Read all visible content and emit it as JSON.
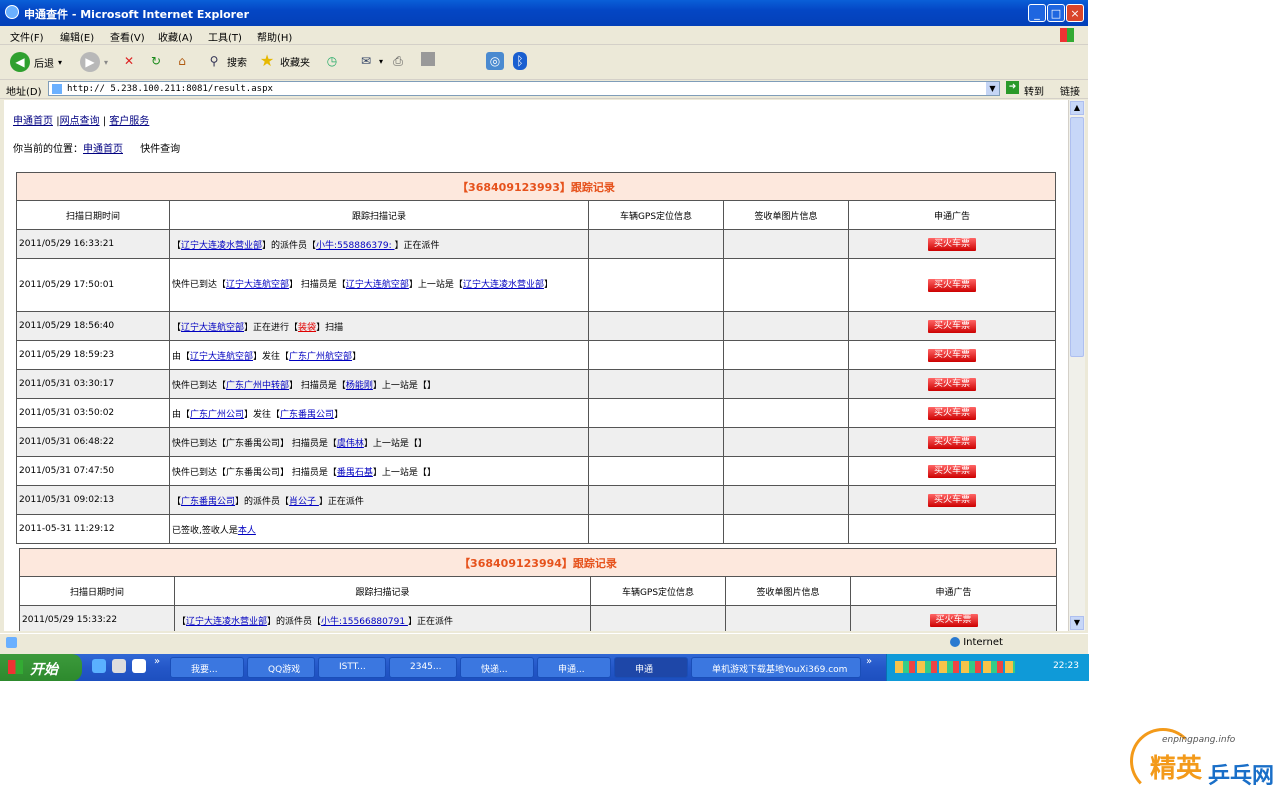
{
  "window": {
    "title": "申通查件 - Microsoft Internet Explorer",
    "min": "_",
    "max": "□",
    "close": "×"
  },
  "menu": [
    "文件(F)",
    "编辑(E)",
    "查看(V)",
    "收藏(A)",
    "工具(T)",
    "帮助(H)"
  ],
  "toolbar": {
    "back": "后退",
    "search": "搜索",
    "favorites": "收藏夹"
  },
  "address": {
    "label": "地址(D)",
    "url": "http://  5.238.100.211:8081/result.aspx",
    "go": "转到",
    "links": "链接"
  },
  "nav": {
    "home": "申通首页",
    "sep1": "|",
    "outlet": "网点查询",
    "sep2": "|",
    "service": "客户服务"
  },
  "breadcrumb": {
    "prefix": "你当前的位置：",
    "home": "申通首页",
    "current": "快件查询"
  },
  "columns": [
    "扫描日期时间",
    "跟踪扫描记录",
    "车辆GPS定位信息",
    "签收单图片信息",
    "申通广告"
  ],
  "ad_label": "买火车票",
  "tracking": [
    {
      "title": "【368409123993】跟踪记录",
      "rows": [
        {
          "time": "2011/05/29 16:33:21",
          "parts": [
            [
              "",
              "【"
            ],
            [
              "b",
              "辽宁大连凌水营业部"
            ],
            [
              "",
              "】的派件员【"
            ],
            [
              "b",
              "小牛:558886379: "
            ],
            [
              "",
              "】正在派件"
            ]
          ],
          "ad": true,
          "tall": false
        },
        {
          "time": "2011/05/29 17:50:01",
          "parts": [
            [
              "",
              "快件已到达【"
            ],
            [
              "b",
              "辽宁大连航空部"
            ],
            [
              "",
              "】 扫描员是【"
            ],
            [
              "b",
              "辽宁大连航空部"
            ],
            [
              "",
              "】上一站是【"
            ],
            [
              "b",
              "辽宁大连凌水营业部"
            ],
            [
              "",
              "】"
            ]
          ],
          "ad": true,
          "tall": true
        },
        {
          "time": "2011/05/29 18:56:40",
          "parts": [
            [
              "",
              "【"
            ],
            [
              "b",
              "辽宁大连航空部"
            ],
            [
              "",
              "】正在进行【"
            ],
            [
              "r",
              "装袋"
            ],
            [
              "",
              "】扫描"
            ]
          ],
          "ad": true,
          "tall": false
        },
        {
          "time": "2011/05/29 18:59:23",
          "parts": [
            [
              "",
              "由【"
            ],
            [
              "b",
              "辽宁大连航空部"
            ],
            [
              "",
              "】发往【"
            ],
            [
              "b",
              "广东广州航空部"
            ],
            [
              "",
              "】"
            ]
          ],
          "ad": true,
          "tall": false
        },
        {
          "time": "2011/05/31 03:30:17",
          "parts": [
            [
              "",
              "快件已到达【"
            ],
            [
              "b",
              "广东广州中转部"
            ],
            [
              "",
              "】 扫描员是【"
            ],
            [
              "b",
              "杨能刚"
            ],
            [
              "",
              "】上一站是【】"
            ]
          ],
          "ad": true,
          "tall": false
        },
        {
          "time": "2011/05/31 03:50:02",
          "parts": [
            [
              "",
              "由【"
            ],
            [
              "b",
              "广东广州公司"
            ],
            [
              "",
              "】发往【"
            ],
            [
              "b",
              "广东番禺公司"
            ],
            [
              "",
              "】"
            ]
          ],
          "ad": true,
          "tall": false
        },
        {
          "time": "2011/05/31 06:48:22",
          "parts": [
            [
              "",
              "快件已到达【广东番禺公司】 扫描员是【"
            ],
            [
              "b",
              "虞伟林"
            ],
            [
              "",
              "】上一站是【】"
            ]
          ],
          "ad": true,
          "tall": false
        },
        {
          "time": "2011/05/31 07:47:50",
          "parts": [
            [
              "",
              "快件已到达【广东番禺公司】 扫描员是【"
            ],
            [
              "b",
              "番禺石基"
            ],
            [
              "",
              "】上一站是【】"
            ]
          ],
          "ad": true,
          "tall": false
        },
        {
          "time": "2011/05/31 09:02:13",
          "parts": [
            [
              "",
              "【"
            ],
            [
              "b",
              "广东番禺公司"
            ],
            [
              "",
              "】的派件员【"
            ],
            [
              "b",
              "肖公子 "
            ],
            [
              "",
              "】正在派件"
            ]
          ],
          "ad": true,
          "tall": false
        },
        {
          "time": "2011-05-31 11:29:12",
          "parts": [
            [
              "",
              "已签收,签收人是"
            ],
            [
              "b",
              "本人"
            ]
          ],
          "ad": false,
          "tall": false
        }
      ]
    },
    {
      "title": "【368409123994】跟踪记录",
      "rows": [
        {
          "time": "2011/05/29 15:33:22",
          "parts": [
            [
              "",
              "【"
            ],
            [
              "b",
              "辽宁大连凌水营业部"
            ],
            [
              "",
              "】的派件员【"
            ],
            [
              "b",
              "小牛:15566880791 "
            ],
            [
              "",
              "】正在派件"
            ]
          ],
          "ad": true,
          "tall": false
        }
      ]
    }
  ],
  "status": {
    "zone": "Internet"
  },
  "taskbar": {
    "start": "开始",
    "tasks": [
      "我要...",
      "QQ游戏",
      "ISTT...",
      "2345...",
      "快递...",
      "申通...",
      "申通",
      "单机游戏下载基地YouXi369.com"
    ],
    "clock": "22:23"
  },
  "watermark": {
    "site": "enpingpang.info",
    "brand_a": "精英",
    "brand_b": "乒乓网"
  }
}
